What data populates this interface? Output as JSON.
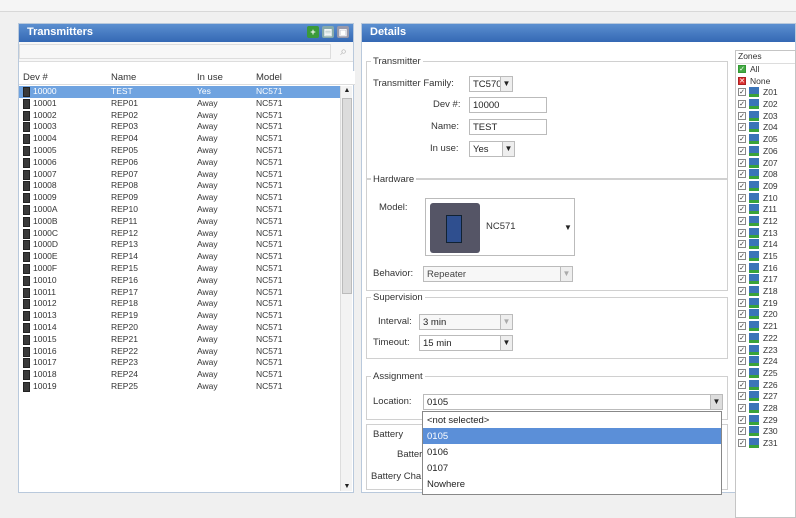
{
  "transmitters": {
    "title": "Transmitters",
    "search_placeholder": "",
    "columns": [
      "Dev #",
      "Name",
      "In use",
      "Model"
    ],
    "rows": [
      [
        "10000",
        "TEST",
        "Yes",
        "NC571"
      ],
      [
        "10001",
        "REP01",
        "Away",
        "NC571"
      ],
      [
        "10002",
        "REP02",
        "Away",
        "NC571"
      ],
      [
        "10003",
        "REP03",
        "Away",
        "NC571"
      ],
      [
        "10004",
        "REP04",
        "Away",
        "NC571"
      ],
      [
        "10005",
        "REP05",
        "Away",
        "NC571"
      ],
      [
        "10006",
        "REP06",
        "Away",
        "NC571"
      ],
      [
        "10007",
        "REP07",
        "Away",
        "NC571"
      ],
      [
        "10008",
        "REP08",
        "Away",
        "NC571"
      ],
      [
        "10009",
        "REP09",
        "Away",
        "NC571"
      ],
      [
        "1000A",
        "REP10",
        "Away",
        "NC571"
      ],
      [
        "1000B",
        "REP11",
        "Away",
        "NC571"
      ],
      [
        "1000C",
        "REP12",
        "Away",
        "NC571"
      ],
      [
        "1000D",
        "REP13",
        "Away",
        "NC571"
      ],
      [
        "1000E",
        "REP14",
        "Away",
        "NC571"
      ],
      [
        "1000F",
        "REP15",
        "Away",
        "NC571"
      ],
      [
        "10010",
        "REP16",
        "Away",
        "NC571"
      ],
      [
        "10011",
        "REP17",
        "Away",
        "NC571"
      ],
      [
        "10012",
        "REP18",
        "Away",
        "NC571"
      ],
      [
        "10013",
        "REP19",
        "Away",
        "NC571"
      ],
      [
        "10014",
        "REP20",
        "Away",
        "NC571"
      ],
      [
        "10015",
        "REP21",
        "Away",
        "NC571"
      ],
      [
        "10016",
        "REP22",
        "Away",
        "NC571"
      ],
      [
        "10017",
        "REP23",
        "Away",
        "NC571"
      ],
      [
        "10018",
        "REP24",
        "Away",
        "NC571"
      ],
      [
        "10019",
        "REP25",
        "Away",
        "NC571"
      ]
    ],
    "selected_index": 0
  },
  "details": {
    "title": "Details",
    "transmitter": {
      "legend": "Transmitter",
      "family_label": "Transmitter Family:",
      "family_value": "TC570",
      "dev_label": "Dev #:",
      "dev_value": "10000",
      "name_label": "Name:",
      "name_value": "TEST",
      "inuse_label": "In use:",
      "inuse_value": "Yes"
    },
    "hardware": {
      "legend": "Hardware",
      "model_label": "Model:",
      "model_value": "NC571",
      "behavior_label": "Behavior:",
      "behavior_value": "Repeater"
    },
    "supervision": {
      "legend": "Supervision",
      "interval_label": "Interval:",
      "interval_value": "3 min",
      "timeout_label": "Timeout:",
      "timeout_value": "15 min"
    },
    "assignment": {
      "legend": "Assignment",
      "location_label": "Location:",
      "location_value": "0105",
      "options": [
        "<not selected>",
        "0105",
        "0106",
        "0107",
        "Nowhere"
      ],
      "highlighted_index": 1
    },
    "battery": {
      "legend": "Battery",
      "battery_label": "Batter",
      "battery_charge_label": "Battery Cha"
    }
  },
  "zones": {
    "header": "Zones",
    "all_label": "All",
    "none_label": "None",
    "items": [
      "Z01",
      "Z02",
      "Z03",
      "Z04",
      "Z05",
      "Z06",
      "Z07",
      "Z08",
      "Z09",
      "Z10",
      "Z11",
      "Z12",
      "Z13",
      "Z14",
      "Z15",
      "Z16",
      "Z17",
      "Z18",
      "Z19",
      "Z20",
      "Z21",
      "Z22",
      "Z23",
      "Z24",
      "Z25",
      "Z26",
      "Z27",
      "Z28",
      "Z29",
      "Z30",
      "Z31"
    ]
  },
  "colors": {
    "header_blue": "#3468b4",
    "selection_blue": "#6fa3e0",
    "highlight_blue": "#5b8fd8"
  },
  "icons": {
    "add": "add-icon",
    "print": "print-icon",
    "save": "save-icon",
    "search": "search-icon"
  }
}
